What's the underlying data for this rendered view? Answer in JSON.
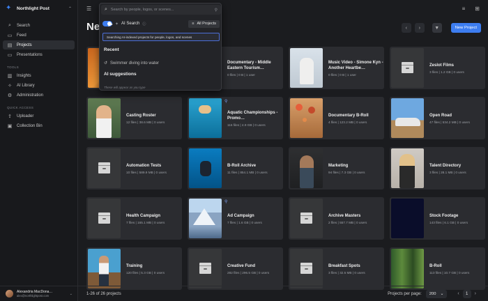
{
  "brand": {
    "name": "Northlight Post"
  },
  "sidebar": {
    "items": [
      {
        "label": "Search",
        "icon": "search-icon"
      },
      {
        "label": "Feed",
        "icon": "feed-icon"
      },
      {
        "label": "Projects",
        "icon": "folder-icon",
        "active": true
      },
      {
        "label": "Presentations",
        "icon": "monitor-icon"
      }
    ],
    "tools_label": "TOOLS",
    "tools": [
      {
        "label": "Insights",
        "icon": "chart-icon"
      },
      {
        "label": "AI Library",
        "icon": "sparkle-icon"
      },
      {
        "label": "Administration",
        "icon": "gear-icon"
      }
    ],
    "quick_label": "QUICK ACCESS",
    "quick": [
      {
        "label": "Uploader",
        "icon": "upload-icon"
      },
      {
        "label": "Collection Bin",
        "icon": "bin-icon"
      }
    ]
  },
  "user": {
    "name": "Alexandria MacDona…",
    "email": "alex@northlightpost.com"
  },
  "page": {
    "title": "Ne",
    "new_project": "New Project"
  },
  "search": {
    "placeholder": "Search by people, logos, or scenes...",
    "ai_label": "AI Search",
    "scope": "All Projects",
    "ai_note": "Searching AI-indexed projects for people, logos, and scenes",
    "recent_label": "Recent",
    "recent": [
      "Swimmer diving into water"
    ],
    "suggestions_label": "AI suggestions",
    "hint": "These will appear as you type"
  },
  "projects": [
    {
      "title": "",
      "meta": "",
      "thumb": "t-orange"
    },
    {
      "title": "Documentary - Middle Eastern Tourism…",
      "meta": "0 files | 0 B | 1 user",
      "thumb": "folder-hidden"
    },
    {
      "title": "Music Video - Simone Kyn - Another Heartbe…",
      "meta": "0 files | 0 B | 1 user",
      "thumb": "t-singer"
    },
    {
      "title": "Zeslot Films",
      "meta": "3 files | 1.2 GB | 0 users",
      "thumb": "folder"
    },
    {
      "title": "Casting Roster",
      "meta": "12 files | 38.6 MB | 0 users",
      "thumb": "t-woman"
    },
    {
      "title": "Aquatic Championships - Promo…",
      "meta": "116 files | 4.9 GB | 0 users",
      "thumb": "t-pool",
      "pinned": true
    },
    {
      "title": "Documentary B-Roll",
      "meta": "4 files | 123.2 MB | 0 users",
      "thumb": "t-desert"
    },
    {
      "title": "Open Road",
      "meta": "47 files | 534.2 MB | 0 users",
      "thumb": "t-car"
    },
    {
      "title": "Automation Tests",
      "meta": "10 files | 589.9 MB | 0 users",
      "thumb": "folder"
    },
    {
      "title": "B-Roll Archive",
      "meta": "11 files | 854.1 MB | 0 users",
      "thumb": "t-diver"
    },
    {
      "title": "Marketing",
      "meta": "94 files | 7.3 GB | 0 users",
      "thumb": "t-man"
    },
    {
      "title": "Talent Directory",
      "meta": "3 files | 28.1 MB | 0 users",
      "thumb": "t-blonde"
    },
    {
      "title": "Health Campaign",
      "meta": "7 files | 165.1 MB | 0 users",
      "thumb": "folder"
    },
    {
      "title": "Ad Campaign",
      "meta": "7 files | 1.6 GB | 0 users",
      "thumb": "t-mountain",
      "pinned": true
    },
    {
      "title": "Archive Masters",
      "meta": "2 files | 557.7 MB | 0 users",
      "thumb": "folder"
    },
    {
      "title": "Stock Footage",
      "meta": "143 files | 6.1 GB | 0 users",
      "thumb": "t-dark"
    },
    {
      "title": "Training",
      "meta": "120 files | 5.3 GB | 0 users",
      "thumb": "t-speaker"
    },
    {
      "title": "Creative Fund",
      "meta": "282 files | 296.5 GB | 0 users",
      "thumb": "folder"
    },
    {
      "title": "Breakfast Spots",
      "meta": "3 files | 32.5 MB | 0 users",
      "thumb": "folder"
    },
    {
      "title": "B-Roll",
      "meta": "113 files | 10.7 GB | 0 users",
      "thumb": "t-forest"
    }
  ],
  "footer": {
    "count": "1-26 of 26 projects",
    "per_page_label": "Projects per page:",
    "per_page": "200",
    "page": "1"
  },
  "colors": {
    "accent": "#3d7df0",
    "background": "#1b1c1f"
  }
}
